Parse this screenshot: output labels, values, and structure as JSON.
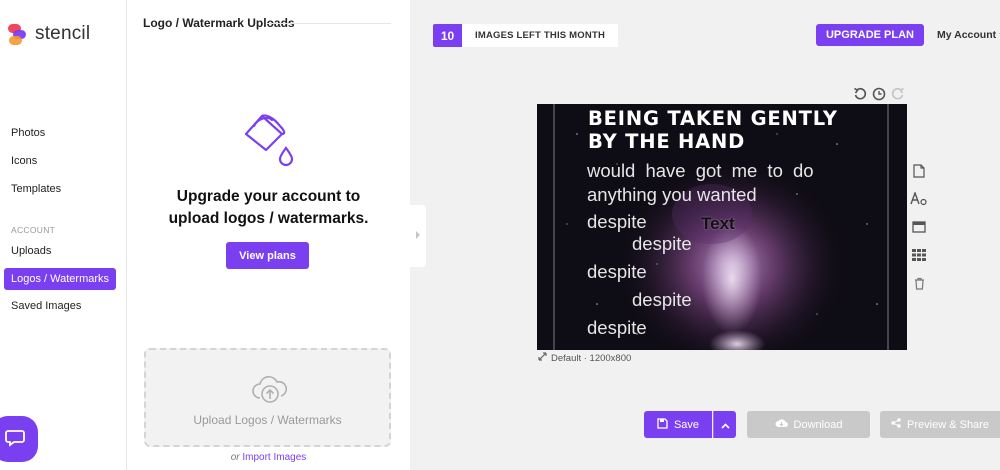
{
  "app": {
    "name": "stencil"
  },
  "sidebar": {
    "items": [
      {
        "label": "Photos"
      },
      {
        "label": "Icons"
      },
      {
        "label": "Templates"
      }
    ],
    "account_section": "ACCOUNT",
    "account_items": [
      {
        "label": "Uploads"
      },
      {
        "label": "Logos / Watermarks",
        "active": true
      },
      {
        "label": "Saved Images"
      }
    ]
  },
  "panel": {
    "title": "Logo / Watermark Uploads",
    "upgrade_line1": "Upgrade your account to",
    "upgrade_line2": "upload logos / watermarks.",
    "view_plans_label": "View plans",
    "dropzone_label": "Upload Logos / Watermarks",
    "import_prefix": "or",
    "import_link": "Import Images"
  },
  "topbar": {
    "images_left": "10",
    "images_left_label": "IMAGES LEFT THIS MONTH",
    "upgrade_label": "UPGRADE PLAN",
    "account_label": "My Account"
  },
  "canvas": {
    "headline1": "BEING TAKEN GENTLY",
    "headline2": "BY THE HAND",
    "body1": "would  have  got  me  to  do",
    "body2": "anything you wanted",
    "body3": "despite",
    "body4": "despite",
    "body5": "despite",
    "body6": "despite",
    "body7": "despite",
    "overlay_text": "Text",
    "size_label": "Default · 1200x800"
  },
  "actions": {
    "save_label": "Save",
    "download_label": "Download",
    "share_label": "Preview & Share"
  },
  "colors": {
    "accent": "#7b3ff2",
    "disabled": "#c9c9c9",
    "workspace_bg": "#f1f1f1"
  }
}
